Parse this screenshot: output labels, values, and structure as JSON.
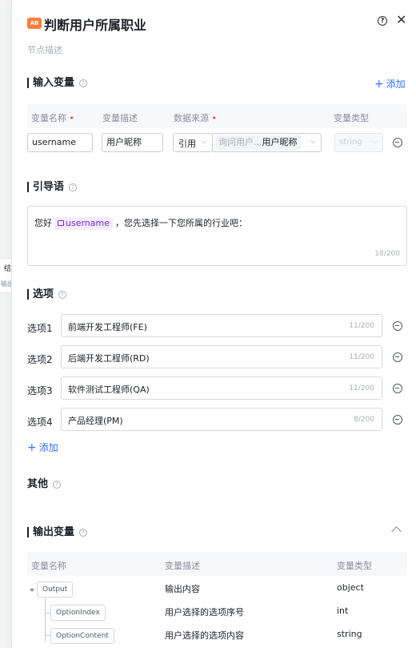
{
  "background": {
    "ghost_title": "结",
    "ghost_sub": "输出"
  },
  "header": {
    "badge": "AB",
    "title": "判断用户所属职业",
    "description_placeholder": "节点描述"
  },
  "input_vars": {
    "title": "输入变量",
    "add_label": "添加",
    "columns": [
      "变量名称",
      "变量描述",
      "数据来源",
      "变量类型"
    ],
    "rows": [
      {
        "name": "username",
        "desc": "用户昵称",
        "source_mode": "引用",
        "source_prefix": "询问用户...",
        "source_value": "用户昵称",
        "type_placeholder": "string"
      }
    ]
  },
  "prompt": {
    "title": "引导语",
    "before": "您好",
    "variable": "username",
    "after": "，您先选择一下您所属的行业吧：",
    "counter": "18/200"
  },
  "options": {
    "title": "选项",
    "add_label": "添加",
    "items": [
      {
        "label": "选项1",
        "value": "前端开发工程师(FE)",
        "counter": "11/200"
      },
      {
        "label": "选项2",
        "value": "后端开发工程师(RD)",
        "counter": "11/200"
      },
      {
        "label": "选项3",
        "value": "软件测试工程师(QA)",
        "counter": "11/200"
      },
      {
        "label": "选项4",
        "value": "产品经理(PM)",
        "counter": "8/200"
      }
    ]
  },
  "other": {
    "title": "其他"
  },
  "output_vars": {
    "title": "输出变量",
    "columns": [
      "变量名称",
      "变量描述",
      "变量类型"
    ],
    "rows": [
      {
        "name": "Output",
        "desc": "输出内容",
        "type": "object"
      },
      {
        "name": "OptionIndex",
        "desc": "用户选择的选项序号",
        "type": "int"
      },
      {
        "name": "OptionContent",
        "desc": "用户选择的选项内容",
        "type": "string"
      }
    ]
  },
  "colors": {
    "accent": "#3370ff",
    "badge": "#ff7d3b",
    "variable_chip": "#722ed1",
    "required": "#f53f3f"
  }
}
